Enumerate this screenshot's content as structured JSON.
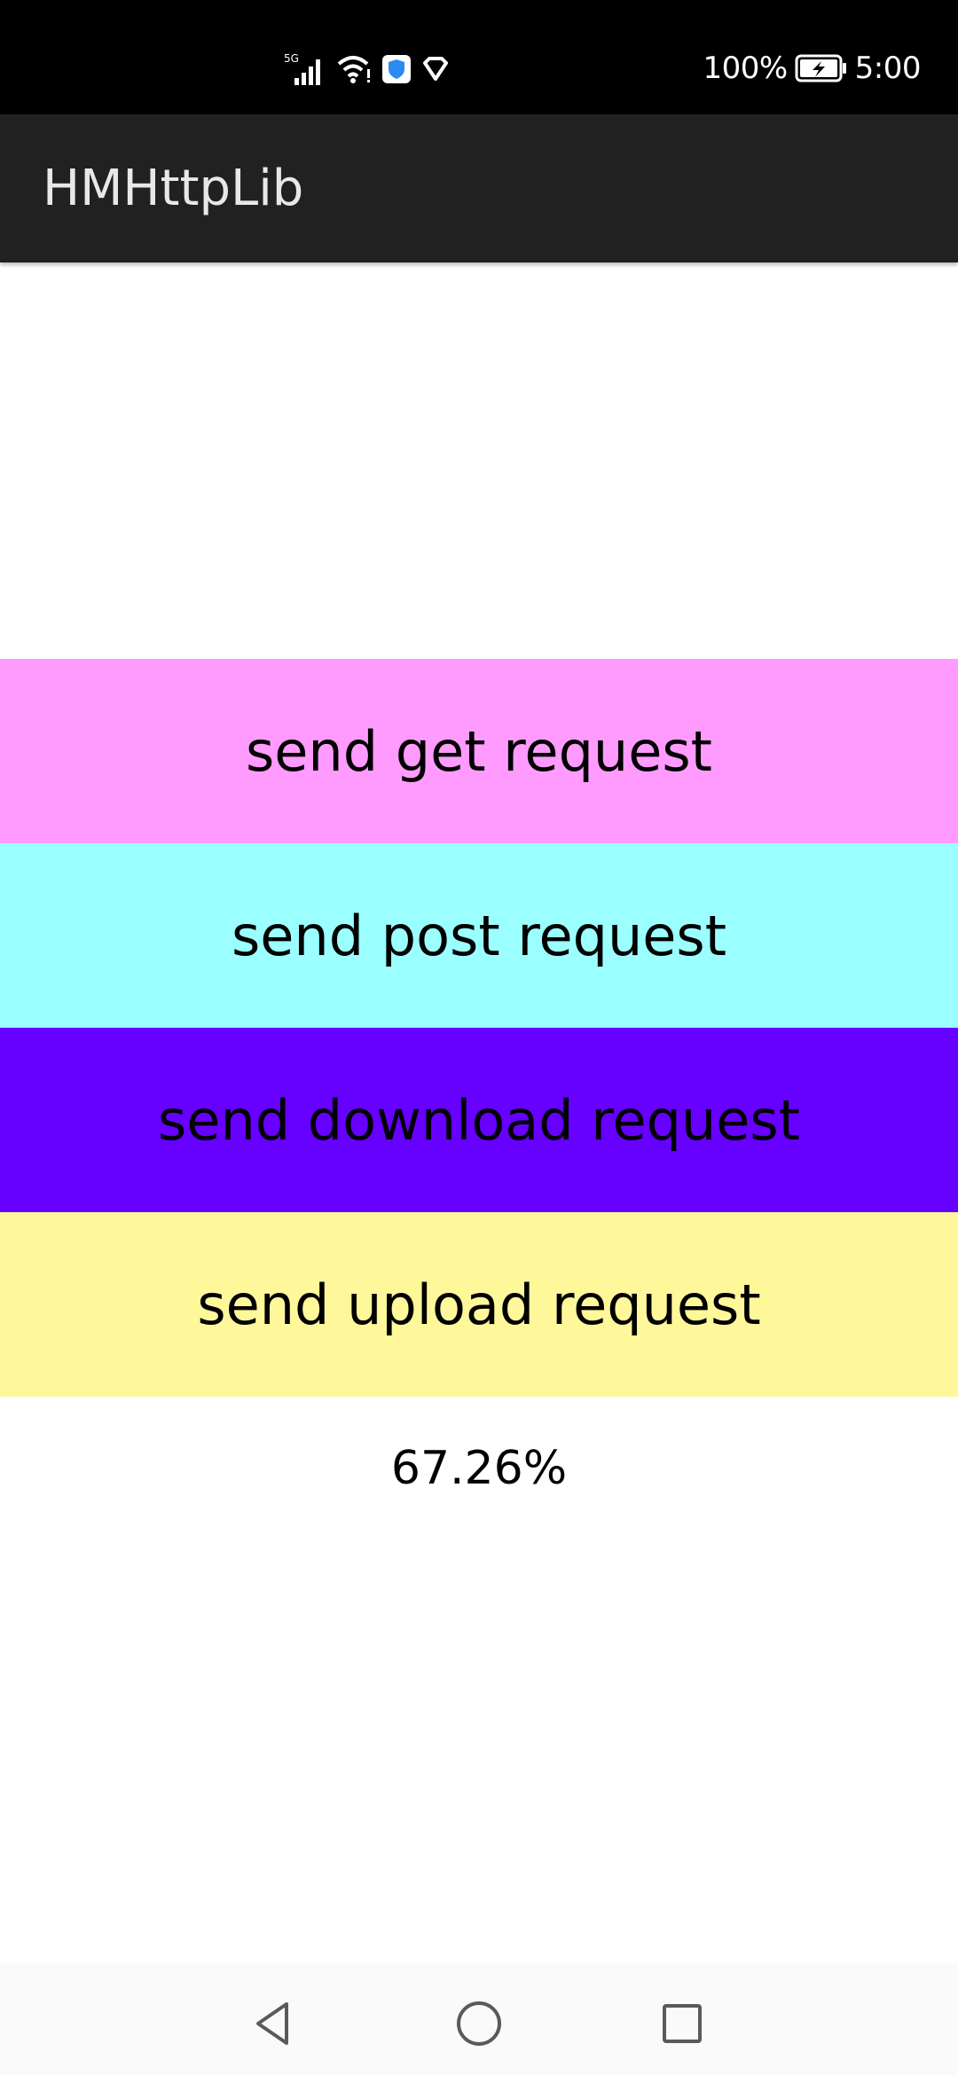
{
  "status_bar": {
    "network_label": "5G",
    "battery": "100%",
    "time": "5:00",
    "icons": [
      "signal-icon",
      "wifi-icon",
      "shield-app-icon",
      "location-icon",
      "battery-charging-icon"
    ]
  },
  "app_bar": {
    "title": "HMHttpLib"
  },
  "buttons": [
    {
      "label": "send get request",
      "color": "#FF9BFF"
    },
    {
      "label": "send post request",
      "color": "#9BFFFF"
    },
    {
      "label": "send download request",
      "color": "#6600FF"
    },
    {
      "label": "send upload request",
      "color": "#FFF89B"
    }
  ],
  "progress": {
    "text": "67.26%"
  },
  "nav_bar": {
    "icons": [
      "back-icon",
      "home-icon",
      "recents-icon"
    ]
  }
}
